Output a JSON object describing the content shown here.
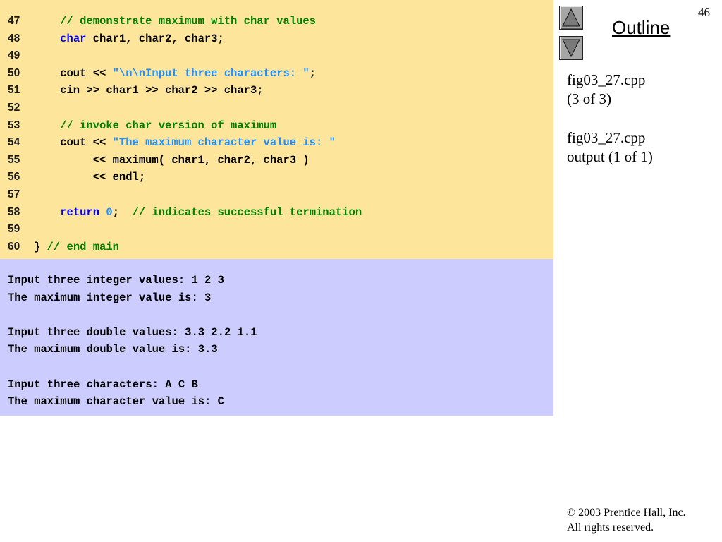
{
  "slide_number": "46",
  "outline": {
    "label": "Outline"
  },
  "nav": {
    "up_icon": "triangle-up-icon",
    "down_icon": "triangle-down-icon"
  },
  "sidebar": {
    "file1": "fig03_27.cpp",
    "file1_part": "(3 of 3)",
    "file2": "fig03_27.cpp",
    "file2_part": "output (1 of 1)"
  },
  "code_lines": [
    {
      "no": "47",
      "tokens": [
        {
          "t": "    ",
          "c": "plain"
        },
        {
          "t": "// demonstrate maximum with char values",
          "c": "comment"
        }
      ]
    },
    {
      "no": "48",
      "tokens": [
        {
          "t": "    ",
          "c": "plain"
        },
        {
          "t": "char",
          "c": "keyword"
        },
        {
          "t": " char1, char2, char3;",
          "c": "plain"
        }
      ]
    },
    {
      "no": "49",
      "tokens": []
    },
    {
      "no": "50",
      "tokens": [
        {
          "t": "    cout << ",
          "c": "plain"
        },
        {
          "t": "\"\\n\\nInput three characters: \"",
          "c": "string"
        },
        {
          "t": ";",
          "c": "plain"
        }
      ]
    },
    {
      "no": "51",
      "tokens": [
        {
          "t": "    cin >> char1 >> char2 >> char3;",
          "c": "plain"
        }
      ]
    },
    {
      "no": "52",
      "tokens": []
    },
    {
      "no": "53",
      "tokens": [
        {
          "t": "    ",
          "c": "plain"
        },
        {
          "t": "// invoke char version of maximum",
          "c": "comment"
        }
      ]
    },
    {
      "no": "54",
      "tokens": [
        {
          "t": "    cout << ",
          "c": "plain"
        },
        {
          "t": "\"The maximum character value is: \"",
          "c": "string"
        }
      ]
    },
    {
      "no": "55",
      "tokens": [
        {
          "t": "         << maximum( char1, char2, char3 )",
          "c": "plain"
        }
      ]
    },
    {
      "no": "56",
      "tokens": [
        {
          "t": "         << endl;",
          "c": "plain"
        }
      ]
    },
    {
      "no": "57",
      "tokens": []
    },
    {
      "no": "58",
      "tokens": [
        {
          "t": "    ",
          "c": "plain"
        },
        {
          "t": "return",
          "c": "keyword"
        },
        {
          "t": " ",
          "c": "plain"
        },
        {
          "t": "0",
          "c": "number"
        },
        {
          "t": ";  ",
          "c": "plain"
        },
        {
          "t": "// indicates successful termination",
          "c": "comment"
        }
      ]
    },
    {
      "no": "59",
      "tokens": []
    },
    {
      "no": "60",
      "tokens": [
        {
          "t": "} ",
          "c": "plain"
        },
        {
          "t": "// end main",
          "c": "comment"
        }
      ]
    }
  ],
  "output_lines": [
    "Input three integer values: 1 2 3",
    "The maximum integer value is: 3",
    "",
    "Input three double values: 3.3 2.2 1.1",
    "The maximum double value is: 3.3",
    "",
    "Input three characters: A C B",
    "The maximum character value is: C"
  ],
  "copyright": {
    "line1": "© 2003 Prentice Hall, Inc.",
    "line2": "All rights reserved."
  },
  "colors": {
    "code_background": "#fde59c",
    "output_background": "#ccccfe",
    "comment": "#008000",
    "keyword": "#0000ff",
    "string": "#1e90ff"
  }
}
